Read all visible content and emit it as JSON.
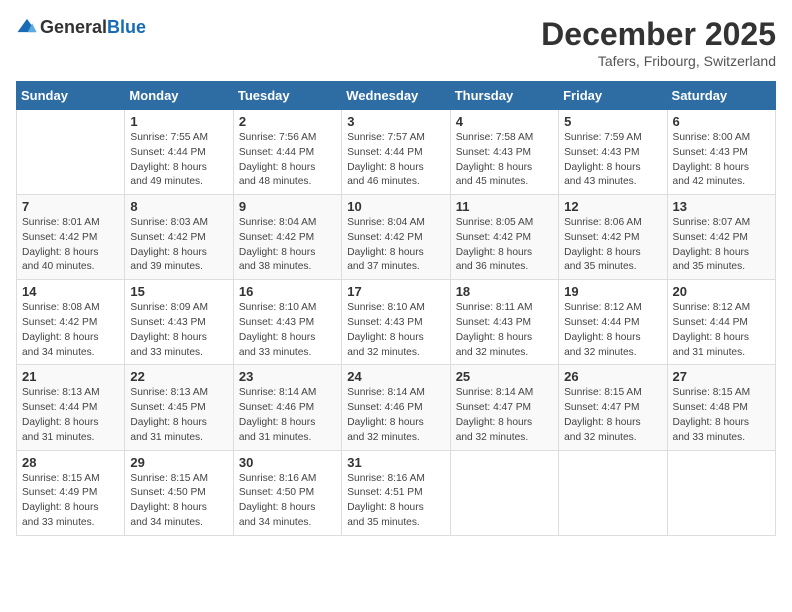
{
  "logo": {
    "general": "General",
    "blue": "Blue"
  },
  "title": "December 2025",
  "location": "Tafers, Fribourg, Switzerland",
  "days_of_week": [
    "Sunday",
    "Monday",
    "Tuesday",
    "Wednesday",
    "Thursday",
    "Friday",
    "Saturday"
  ],
  "weeks": [
    [
      {
        "day": "",
        "info": ""
      },
      {
        "day": "1",
        "info": "Sunrise: 7:55 AM\nSunset: 4:44 PM\nDaylight: 8 hours\nand 49 minutes."
      },
      {
        "day": "2",
        "info": "Sunrise: 7:56 AM\nSunset: 4:44 PM\nDaylight: 8 hours\nand 48 minutes."
      },
      {
        "day": "3",
        "info": "Sunrise: 7:57 AM\nSunset: 4:44 PM\nDaylight: 8 hours\nand 46 minutes."
      },
      {
        "day": "4",
        "info": "Sunrise: 7:58 AM\nSunset: 4:43 PM\nDaylight: 8 hours\nand 45 minutes."
      },
      {
        "day": "5",
        "info": "Sunrise: 7:59 AM\nSunset: 4:43 PM\nDaylight: 8 hours\nand 43 minutes."
      },
      {
        "day": "6",
        "info": "Sunrise: 8:00 AM\nSunset: 4:43 PM\nDaylight: 8 hours\nand 42 minutes."
      }
    ],
    [
      {
        "day": "7",
        "info": "Sunrise: 8:01 AM\nSunset: 4:42 PM\nDaylight: 8 hours\nand 40 minutes."
      },
      {
        "day": "8",
        "info": "Sunrise: 8:03 AM\nSunset: 4:42 PM\nDaylight: 8 hours\nand 39 minutes."
      },
      {
        "day": "9",
        "info": "Sunrise: 8:04 AM\nSunset: 4:42 PM\nDaylight: 8 hours\nand 38 minutes."
      },
      {
        "day": "10",
        "info": "Sunrise: 8:04 AM\nSunset: 4:42 PM\nDaylight: 8 hours\nand 37 minutes."
      },
      {
        "day": "11",
        "info": "Sunrise: 8:05 AM\nSunset: 4:42 PM\nDaylight: 8 hours\nand 36 minutes."
      },
      {
        "day": "12",
        "info": "Sunrise: 8:06 AM\nSunset: 4:42 PM\nDaylight: 8 hours\nand 35 minutes."
      },
      {
        "day": "13",
        "info": "Sunrise: 8:07 AM\nSunset: 4:42 PM\nDaylight: 8 hours\nand 35 minutes."
      }
    ],
    [
      {
        "day": "14",
        "info": "Sunrise: 8:08 AM\nSunset: 4:42 PM\nDaylight: 8 hours\nand 34 minutes."
      },
      {
        "day": "15",
        "info": "Sunrise: 8:09 AM\nSunset: 4:43 PM\nDaylight: 8 hours\nand 33 minutes."
      },
      {
        "day": "16",
        "info": "Sunrise: 8:10 AM\nSunset: 4:43 PM\nDaylight: 8 hours\nand 33 minutes."
      },
      {
        "day": "17",
        "info": "Sunrise: 8:10 AM\nSunset: 4:43 PM\nDaylight: 8 hours\nand 32 minutes."
      },
      {
        "day": "18",
        "info": "Sunrise: 8:11 AM\nSunset: 4:43 PM\nDaylight: 8 hours\nand 32 minutes."
      },
      {
        "day": "19",
        "info": "Sunrise: 8:12 AM\nSunset: 4:44 PM\nDaylight: 8 hours\nand 32 minutes."
      },
      {
        "day": "20",
        "info": "Sunrise: 8:12 AM\nSunset: 4:44 PM\nDaylight: 8 hours\nand 31 minutes."
      }
    ],
    [
      {
        "day": "21",
        "info": "Sunrise: 8:13 AM\nSunset: 4:44 PM\nDaylight: 8 hours\nand 31 minutes."
      },
      {
        "day": "22",
        "info": "Sunrise: 8:13 AM\nSunset: 4:45 PM\nDaylight: 8 hours\nand 31 minutes."
      },
      {
        "day": "23",
        "info": "Sunrise: 8:14 AM\nSunset: 4:46 PM\nDaylight: 8 hours\nand 31 minutes."
      },
      {
        "day": "24",
        "info": "Sunrise: 8:14 AM\nSunset: 4:46 PM\nDaylight: 8 hours\nand 32 minutes."
      },
      {
        "day": "25",
        "info": "Sunrise: 8:14 AM\nSunset: 4:47 PM\nDaylight: 8 hours\nand 32 minutes."
      },
      {
        "day": "26",
        "info": "Sunrise: 8:15 AM\nSunset: 4:47 PM\nDaylight: 8 hours\nand 32 minutes."
      },
      {
        "day": "27",
        "info": "Sunrise: 8:15 AM\nSunset: 4:48 PM\nDaylight: 8 hours\nand 33 minutes."
      }
    ],
    [
      {
        "day": "28",
        "info": "Sunrise: 8:15 AM\nSunset: 4:49 PM\nDaylight: 8 hours\nand 33 minutes."
      },
      {
        "day": "29",
        "info": "Sunrise: 8:15 AM\nSunset: 4:50 PM\nDaylight: 8 hours\nand 34 minutes."
      },
      {
        "day": "30",
        "info": "Sunrise: 8:16 AM\nSunset: 4:50 PM\nDaylight: 8 hours\nand 34 minutes."
      },
      {
        "day": "31",
        "info": "Sunrise: 8:16 AM\nSunset: 4:51 PM\nDaylight: 8 hours\nand 35 minutes."
      },
      {
        "day": "",
        "info": ""
      },
      {
        "day": "",
        "info": ""
      },
      {
        "day": "",
        "info": ""
      }
    ]
  ]
}
